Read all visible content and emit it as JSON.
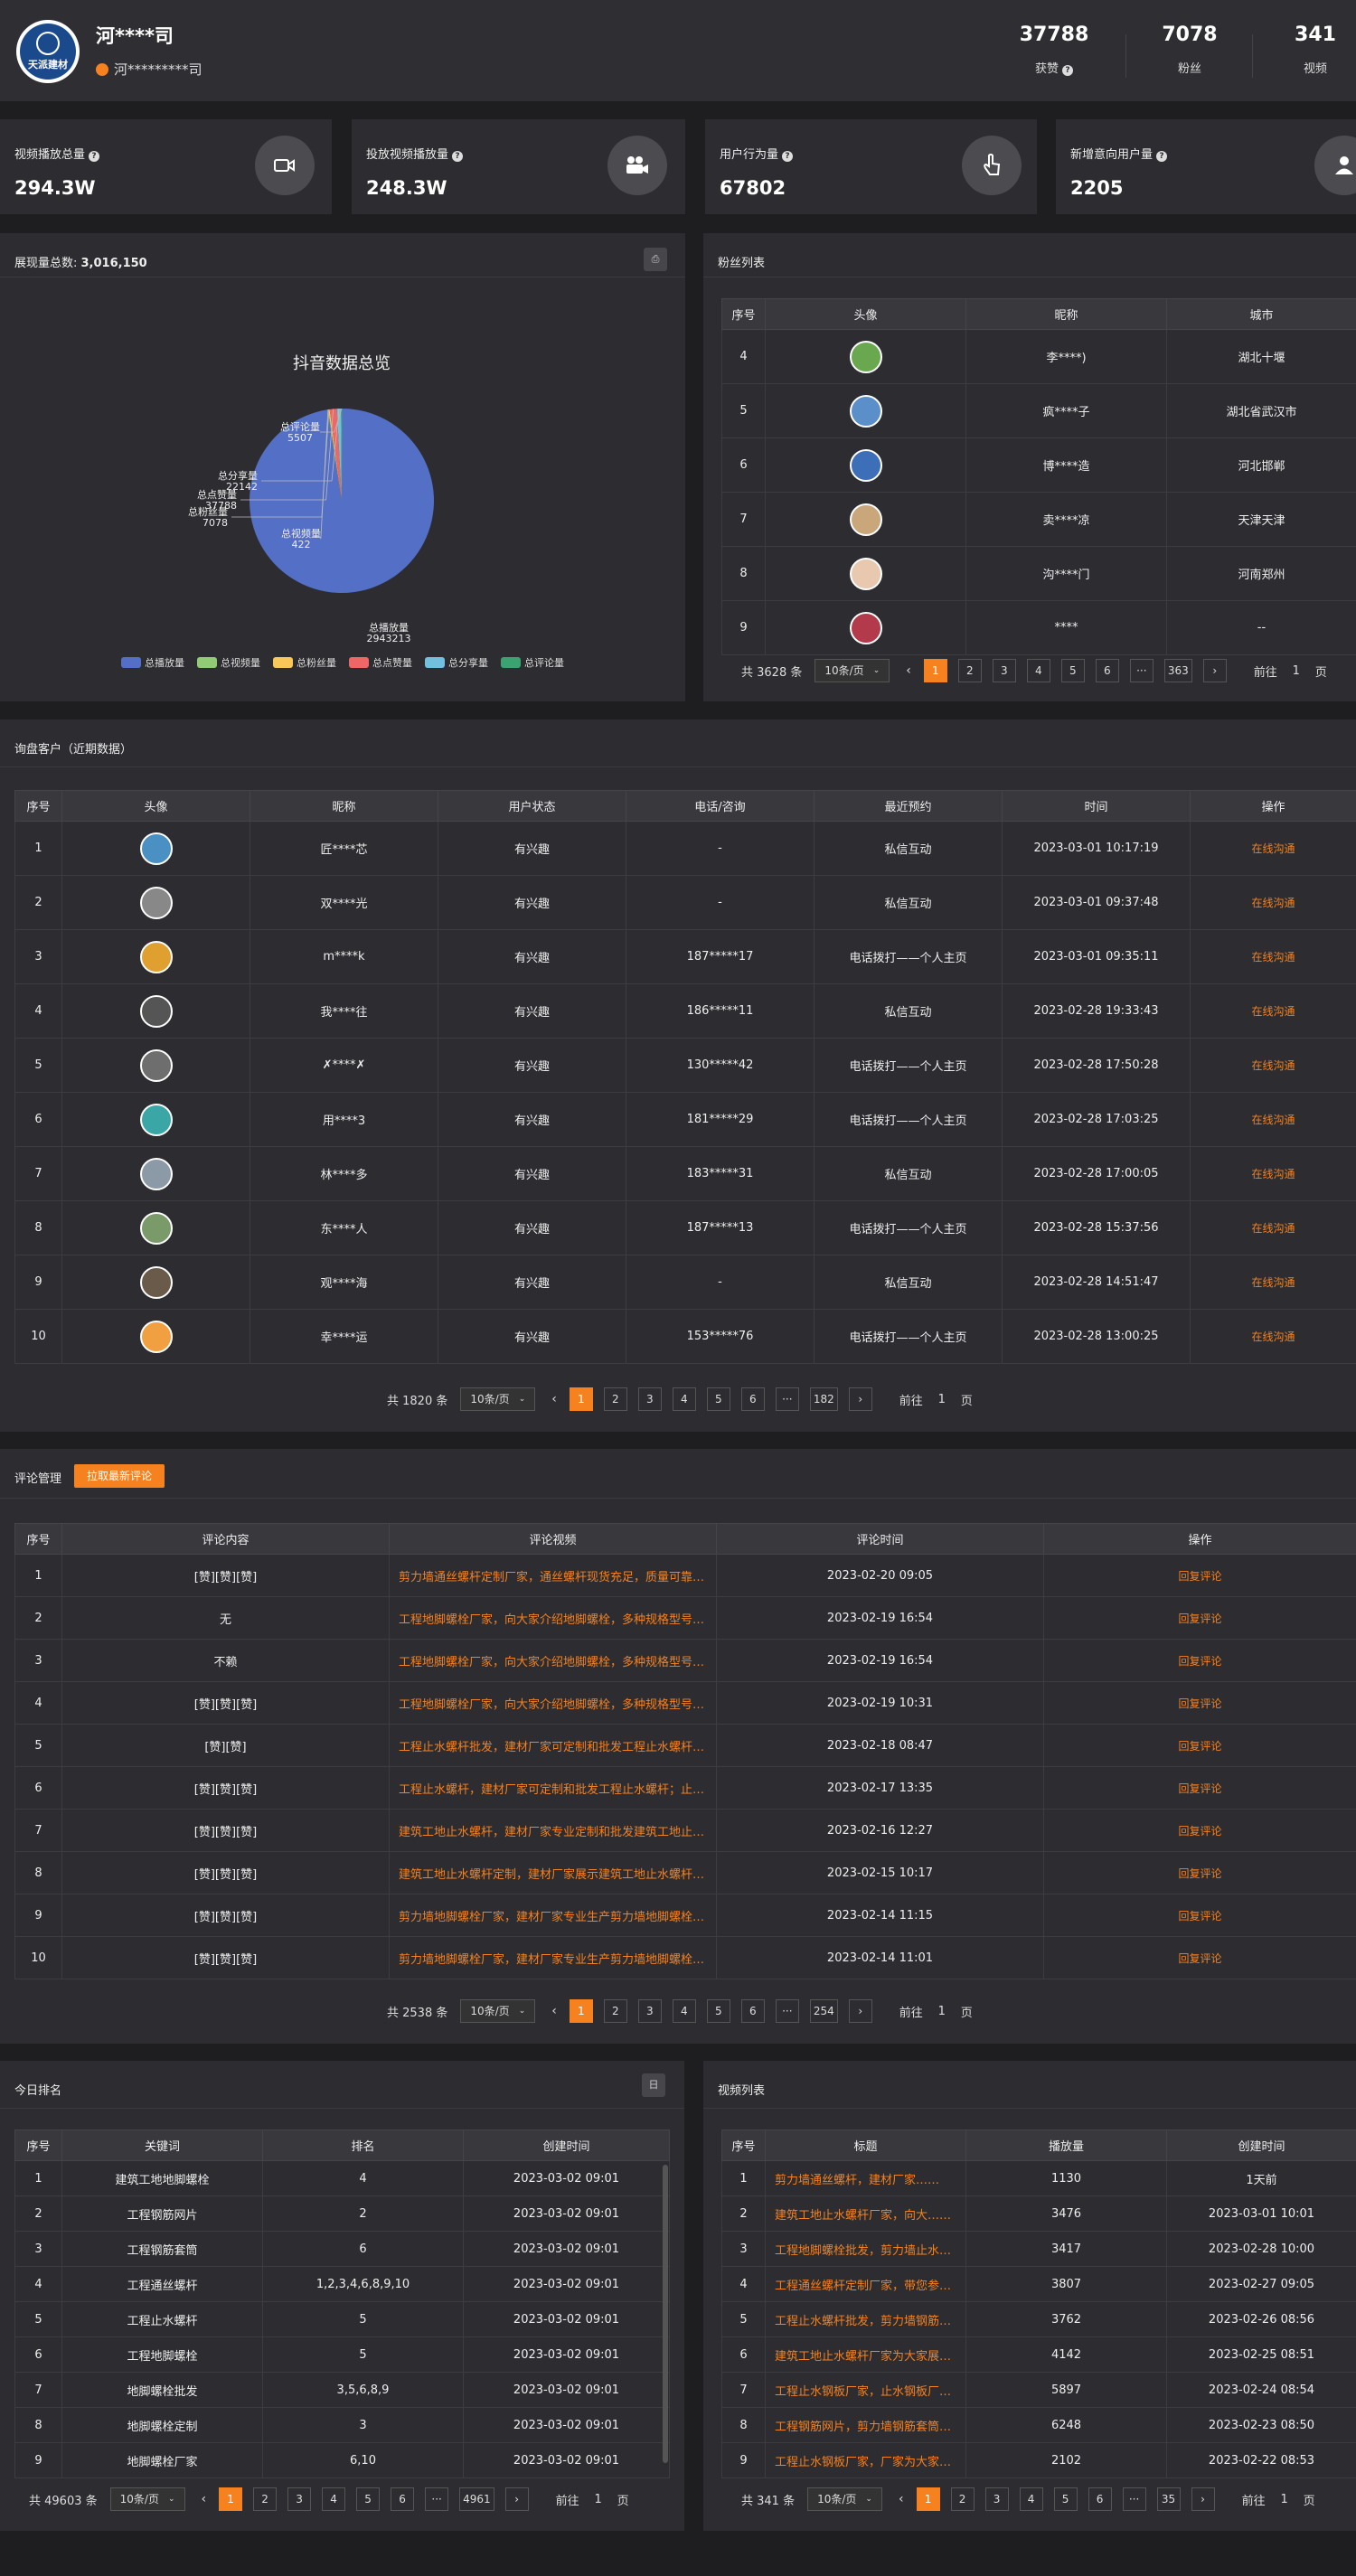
{
  "header": {
    "logo_text": "天派建材",
    "name": "河****司",
    "sub": "河*********司",
    "stats": [
      {
        "value": "37788",
        "label": "获赞"
      },
      {
        "value": "7078",
        "label": "粉丝"
      },
      {
        "value": "341",
        "label": "视频"
      }
    ]
  },
  "cards": [
    {
      "title": "视频播放总量",
      "value": "294.3W",
      "icon": "video-camera-icon"
    },
    {
      "title": "投放视频播放量",
      "value": "248.3W",
      "icon": "movie-camera-icon"
    },
    {
      "title": "用户行为量",
      "value": "67802",
      "icon": "hand-pointer-icon"
    },
    {
      "title": "新增意向用户量",
      "value": "2205",
      "icon": "user-icon"
    }
  ],
  "chart_panel": {
    "title_prefix": "展现量总数: ",
    "title_value": "3,016,150",
    "corner_btn": "⎙"
  },
  "chart_data": {
    "type": "pie",
    "title": "抖音数据总览",
    "slices": [
      {
        "name": "总播放量",
        "value": 2943213,
        "color": "#5470c6"
      },
      {
        "name": "总视频量",
        "value": 422,
        "color": "#91cc75"
      },
      {
        "name": "总粉丝量",
        "value": 7078,
        "color": "#fac858"
      },
      {
        "name": "总点赞量",
        "value": 37788,
        "color": "#ee6666"
      },
      {
        "name": "总分享量",
        "value": 22142,
        "color": "#73c0de"
      },
      {
        "name": "总评论量",
        "value": 5507,
        "color": "#3ba272"
      }
    ],
    "legend_position": "bottom"
  },
  "fans": {
    "title": "粉丝列表",
    "headers": [
      "序号",
      "头像",
      "昵称",
      "城市"
    ],
    "rows": [
      {
        "no": "4",
        "name": "李****)",
        "city": "湖北十堰",
        "av": "#6aa84f"
      },
      {
        "no": "5",
        "name": "疯****子",
        "city": "湖北省武汉市",
        "av": "#5b8fc9"
      },
      {
        "no": "6",
        "name": "博****造",
        "city": "河北邯郸",
        "av": "#3d6fb8"
      },
      {
        "no": "7",
        "name": "卖****凉",
        "city": "天津天津",
        "av": "#c9a77a"
      },
      {
        "no": "8",
        "name": "沟****门",
        "city": "河南郑州",
        "av": "#e8c9b0"
      },
      {
        "no": "9",
        "name": "****",
        "city": "--",
        "av": "#b33a4a"
      }
    ],
    "pager": {
      "total": "共 3628 条",
      "size": "10条/页",
      "pages": [
        "1",
        "2",
        "3",
        "4",
        "5",
        "6",
        "···",
        "363"
      ],
      "goto": "前往",
      "goto_val": "1",
      "page_unit": "页"
    }
  },
  "customers": {
    "title": "询盘客户（近期数据）",
    "headers": [
      "序号",
      "头像",
      "昵称",
      "用户状态",
      "电话/咨询",
      "最近预约",
      "时间",
      "操作"
    ],
    "rows": [
      {
        "no": "1",
        "name": "匠****芯",
        "status": "有兴趣",
        "phone": "-",
        "appt": "私信互动",
        "time": "2023-03-01 10:17:19",
        "op": "在线沟通",
        "av": "#4a90c2"
      },
      {
        "no": "2",
        "name": "双****光",
        "status": "有兴趣",
        "phone": "-",
        "appt": "私信互动",
        "time": "2023-03-01 09:37:48",
        "op": "在线沟通",
        "av": "#888888"
      },
      {
        "no": "3",
        "name": "m****k",
        "status": "有兴趣",
        "phone": "187*****17",
        "appt": "电话拨打——个人主页",
        "time": "2023-03-01 09:35:11",
        "op": "在线沟通",
        "av": "#e0a030"
      },
      {
        "no": "4",
        "name": "我****往",
        "status": "有兴趣",
        "phone": "186*****11",
        "appt": "私信互动",
        "time": "2023-02-28 19:33:43",
        "op": "在线沟通",
        "av": "#555555"
      },
      {
        "no": "5",
        "name": "✗****✗",
        "status": "有兴趣",
        "phone": "130*****42",
        "appt": "电话拨打——个人主页",
        "time": "2023-02-28 17:50:28",
        "op": "在线沟通",
        "av": "#6e6e6e"
      },
      {
        "no": "6",
        "name": "用****3",
        "status": "有兴趣",
        "phone": "181*****29",
        "appt": "电话拨打——个人主页",
        "time": "2023-02-28 17:03:25",
        "op": "在线沟通",
        "av": "#3aa6a6"
      },
      {
        "no": "7",
        "name": "林****多",
        "status": "有兴趣",
        "phone": "183*****31",
        "appt": "私信互动",
        "time": "2023-02-28 17:00:05",
        "op": "在线沟通",
        "av": "#8c9aa8"
      },
      {
        "no": "8",
        "name": "东****人",
        "status": "有兴趣",
        "phone": "187*****13",
        "appt": "电话拨打——个人主页",
        "time": "2023-02-28 15:37:56",
        "op": "在线沟通",
        "av": "#7a9a6a"
      },
      {
        "no": "9",
        "name": "观****海",
        "status": "有兴趣",
        "phone": "-",
        "appt": "私信互动",
        "time": "2023-02-28 14:51:47",
        "op": "在线沟通",
        "av": "#6a5a4a"
      },
      {
        "no": "10",
        "name": "幸****运",
        "status": "有兴趣",
        "phone": "153*****76",
        "appt": "电话拨打——个人主页",
        "time": "2023-02-28 13:00:25",
        "op": "在线沟通",
        "av": "#f0a040"
      }
    ],
    "pager": {
      "total": "共 1820 条",
      "size": "10条/页",
      "pages": [
        "1",
        "2",
        "3",
        "4",
        "5",
        "6",
        "···",
        "182"
      ],
      "goto": "前往",
      "goto_val": "1",
      "page_unit": "页"
    }
  },
  "comments": {
    "title": "评论管理",
    "pull_btn": "拉取最新评论",
    "headers": [
      "序号",
      "评论内容",
      "评论视频",
      "评论时间",
      "操作"
    ],
    "rows": [
      {
        "no": "1",
        "content": "[赞][赞][赞]",
        "video": "剪力墙通丝螺杆定制厂家，通丝螺杆现货充足，质量可靠……",
        "time": "2023-02-20 09:05",
        "op": "回复评论"
      },
      {
        "no": "2",
        "content": "无",
        "video": "工程地脚螺栓厂家，向大家介绍地脚螺栓，多种规格型号……",
        "time": "2023-02-19 16:54",
        "op": "回复评论"
      },
      {
        "no": "3",
        "content": "不赖",
        "video": "工程地脚螺栓厂家，向大家介绍地脚螺栓，多种规格型号……",
        "time": "2023-02-19 16:54",
        "op": "回复评论"
      },
      {
        "no": "4",
        "content": "[赞][赞][赞]",
        "video": "工程地脚螺栓厂家，向大家介绍地脚螺栓，多种规格型号……",
        "time": "2023-02-19 10:31",
        "op": "回复评论"
      },
      {
        "no": "5",
        "content": "[赞][赞]",
        "video": "工程止水螺杆批发，建材厂家可定制和批发工程止水螺杆……",
        "time": "2023-02-18 08:47",
        "op": "回复评论"
      },
      {
        "no": "6",
        "content": "[赞][赞][赞]",
        "video": "工程止水螺杆，建材厂家可定制和批发工程止水螺杆；止……",
        "time": "2023-02-17 13:35",
        "op": "回复评论"
      },
      {
        "no": "7",
        "content": "[赞][赞][赞]",
        "video": "建筑工地止水螺杆，建材厂家专业定制和批发建筑工地止……",
        "time": "2023-02-16 12:27",
        "op": "回复评论"
      },
      {
        "no": "8",
        "content": "[赞][赞][赞]",
        "video": "建筑工地止水螺杆定制，建材厂家展示建筑工地止水螺杆……",
        "time": "2023-02-15 10:17",
        "op": "回复评论"
      },
      {
        "no": "9",
        "content": "[赞][赞][赞]",
        "video": "剪力墙地脚螺栓厂家，建材厂家专业生产剪力墙地脚螺栓……",
        "time": "2023-02-14 11:15",
        "op": "回复评论"
      },
      {
        "no": "10",
        "content": "[赞][赞][赞]",
        "video": "剪力墙地脚螺栓厂家，建材厂家专业生产剪力墙地脚螺栓……",
        "time": "2023-02-14 11:01",
        "op": "回复评论"
      }
    ],
    "pager": {
      "total": "共 2538 条",
      "size": "10条/页",
      "pages": [
        "1",
        "2",
        "3",
        "4",
        "5",
        "6",
        "···",
        "254"
      ],
      "goto": "前往",
      "goto_val": "1",
      "page_unit": "页"
    }
  },
  "ranking": {
    "title": "今日排名",
    "corner_btn": "日",
    "headers": [
      "序号",
      "关键词",
      "排名",
      "创建时间"
    ],
    "rows": [
      {
        "no": "1",
        "kw": "建筑工地地脚螺栓",
        "rank": "4",
        "time": "2023-03-02 09:01"
      },
      {
        "no": "2",
        "kw": "工程钢筋网片",
        "rank": "2",
        "time": "2023-03-02 09:01"
      },
      {
        "no": "3",
        "kw": "工程钢筋套筒",
        "rank": "6",
        "time": "2023-03-02 09:01"
      },
      {
        "no": "4",
        "kw": "工程通丝螺杆",
        "rank": "1,2,3,4,6,8,9,10",
        "time": "2023-03-02 09:01"
      },
      {
        "no": "5",
        "kw": "工程止水螺杆",
        "rank": "5",
        "time": "2023-03-02 09:01"
      },
      {
        "no": "6",
        "kw": "工程地脚螺栓",
        "rank": "5",
        "time": "2023-03-02 09:01"
      },
      {
        "no": "7",
        "kw": "地脚螺栓批发",
        "rank": "3,5,6,8,9",
        "time": "2023-03-02 09:01"
      },
      {
        "no": "8",
        "kw": "地脚螺栓定制",
        "rank": "3",
        "time": "2023-03-02 09:01"
      },
      {
        "no": "9",
        "kw": "地脚螺栓厂家",
        "rank": "6,10",
        "time": "2023-03-02 09:01"
      }
    ],
    "pager": {
      "total": "共 49603 条",
      "size": "10条/页",
      "pages": [
        "1",
        "2",
        "3",
        "4",
        "5",
        "6",
        "···",
        "4961"
      ],
      "goto": "前往",
      "goto_val": "1",
      "page_unit": "页"
    }
  },
  "videos": {
    "title": "视频列表",
    "headers": [
      "序号",
      "标题",
      "播放量",
      "创建时间"
    ],
    "rows": [
      {
        "no": "1",
        "title": "剪力墙通丝螺杆，建材厂家……",
        "plays": "1130",
        "time": "1天前"
      },
      {
        "no": "2",
        "title": "建筑工地止水螺杆厂家，向大……",
        "plays": "3476",
        "time": "2023-03-01 10:01"
      },
      {
        "no": "3",
        "title": "工程地脚螺栓批发，剪力墙止水……",
        "plays": "3417",
        "time": "2023-02-28 10:00"
      },
      {
        "no": "4",
        "title": "工程通丝螺杆定制厂家，带您参……",
        "plays": "3807",
        "time": "2023-02-27 09:05"
      },
      {
        "no": "5",
        "title": "工程止水螺杆批发，剪力墙钢筋……",
        "plays": "3762",
        "time": "2023-02-26 08:56"
      },
      {
        "no": "6",
        "title": "建筑工地止水螺杆厂家为大家展……",
        "plays": "4142",
        "time": "2023-02-25 08:51"
      },
      {
        "no": "7",
        "title": "工程止水钢板厂家，止水钢板厂……",
        "plays": "5897",
        "time": "2023-02-24 08:54"
      },
      {
        "no": "8",
        "title": "工程钢筋网片，剪力墙钢筋套筒……",
        "plays": "6248",
        "time": "2023-02-23 08:50"
      },
      {
        "no": "9",
        "title": "工程止水钢板厂家，厂家为大家……",
        "plays": "2102",
        "time": "2023-02-22 08:53"
      }
    ],
    "pager": {
      "total": "共 341 条",
      "size": "10条/页",
      "pages": [
        "1",
        "2",
        "3",
        "4",
        "5",
        "6",
        "···",
        "35"
      ],
      "goto": "前往",
      "goto_val": "1",
      "page_unit": "页"
    }
  }
}
